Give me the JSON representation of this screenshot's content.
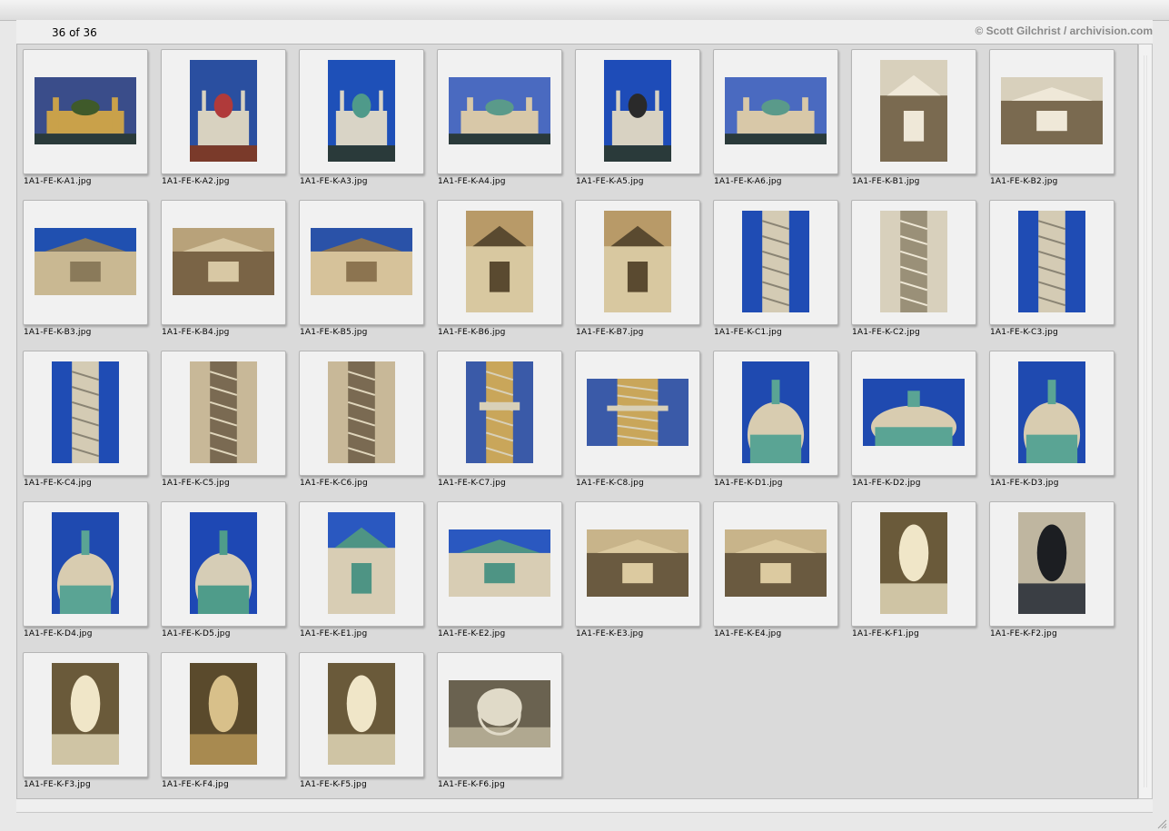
{
  "header": {
    "count": "36 of 36",
    "credit": "© Scott Gilchrist / archivision.com"
  },
  "images": [
    {
      "filename": "1A1-FE-K-A1.jpg",
      "orientation": "landscape",
      "subject": "pavilion"
    },
    {
      "filename": "1A1-FE-K-A2.jpg",
      "orientation": "portrait",
      "subject": "church-garden"
    },
    {
      "filename": "1A1-FE-K-A3.jpg",
      "orientation": "portrait",
      "subject": "church-facade"
    },
    {
      "filename": "1A1-FE-K-A4.jpg",
      "orientation": "landscape",
      "subject": "church-wide"
    },
    {
      "filename": "1A1-FE-K-A5.jpg",
      "orientation": "portrait",
      "subject": "church-pool"
    },
    {
      "filename": "1A1-FE-K-A6.jpg",
      "orientation": "landscape",
      "subject": "church-wide"
    },
    {
      "filename": "1A1-FE-K-B1.jpg",
      "orientation": "portrait",
      "subject": "portico"
    },
    {
      "filename": "1A1-FE-K-B2.jpg",
      "orientation": "landscape",
      "subject": "portico"
    },
    {
      "filename": "1A1-FE-K-B3.jpg",
      "orientation": "landscape",
      "subject": "pediment"
    },
    {
      "filename": "1A1-FE-K-B4.jpg",
      "orientation": "landscape",
      "subject": "relief"
    },
    {
      "filename": "1A1-FE-K-B5.jpg",
      "orientation": "landscape",
      "subject": "statue-sky"
    },
    {
      "filename": "1A1-FE-K-B6.jpg",
      "orientation": "portrait",
      "subject": "statue"
    },
    {
      "filename": "1A1-FE-K-B7.jpg",
      "orientation": "portrait",
      "subject": "statue"
    },
    {
      "filename": "1A1-FE-K-C1.jpg",
      "orientation": "portrait",
      "subject": "column"
    },
    {
      "filename": "1A1-FE-K-C2.jpg",
      "orientation": "portrait",
      "subject": "column-base"
    },
    {
      "filename": "1A1-FE-K-C3.jpg",
      "orientation": "portrait",
      "subject": "column"
    },
    {
      "filename": "1A1-FE-K-C4.jpg",
      "orientation": "portrait",
      "subject": "column"
    },
    {
      "filename": "1A1-FE-K-C5.jpg",
      "orientation": "portrait",
      "subject": "column-relief"
    },
    {
      "filename": "1A1-FE-K-C6.jpg",
      "orientation": "portrait",
      "subject": "column-relief"
    },
    {
      "filename": "1A1-FE-K-C7.jpg",
      "orientation": "portrait",
      "subject": "column-top"
    },
    {
      "filename": "1A1-FE-K-C8.jpg",
      "orientation": "landscape",
      "subject": "column-top"
    },
    {
      "filename": "1A1-FE-K-D1.jpg",
      "orientation": "portrait",
      "subject": "dome"
    },
    {
      "filename": "1A1-FE-K-D2.jpg",
      "orientation": "landscape",
      "subject": "dome"
    },
    {
      "filename": "1A1-FE-K-D3.jpg",
      "orientation": "portrait",
      "subject": "dome"
    },
    {
      "filename": "1A1-FE-K-D4.jpg",
      "orientation": "portrait",
      "subject": "dome"
    },
    {
      "filename": "1A1-FE-K-D5.jpg",
      "orientation": "portrait",
      "subject": "lantern"
    },
    {
      "filename": "1A1-FE-K-E1.jpg",
      "orientation": "portrait",
      "subject": "tower"
    },
    {
      "filename": "1A1-FE-K-E2.jpg",
      "orientation": "landscape",
      "subject": "tower"
    },
    {
      "filename": "1A1-FE-K-E3.jpg",
      "orientation": "landscape",
      "subject": "facade-detail"
    },
    {
      "filename": "1A1-FE-K-E4.jpg",
      "orientation": "landscape",
      "subject": "facade-detail"
    },
    {
      "filename": "1A1-FE-K-F1.jpg",
      "orientation": "portrait",
      "subject": "interior"
    },
    {
      "filename": "1A1-FE-K-F2.jpg",
      "orientation": "portrait",
      "subject": "interior-dark"
    },
    {
      "filename": "1A1-FE-K-F3.jpg",
      "orientation": "portrait",
      "subject": "interior"
    },
    {
      "filename": "1A1-FE-K-F4.jpg",
      "orientation": "portrait",
      "subject": "interior-altar"
    },
    {
      "filename": "1A1-FE-K-F5.jpg",
      "orientation": "portrait",
      "subject": "interior"
    },
    {
      "filename": "1A1-FE-K-F6.jpg",
      "orientation": "landscape",
      "subject": "ceiling"
    }
  ]
}
